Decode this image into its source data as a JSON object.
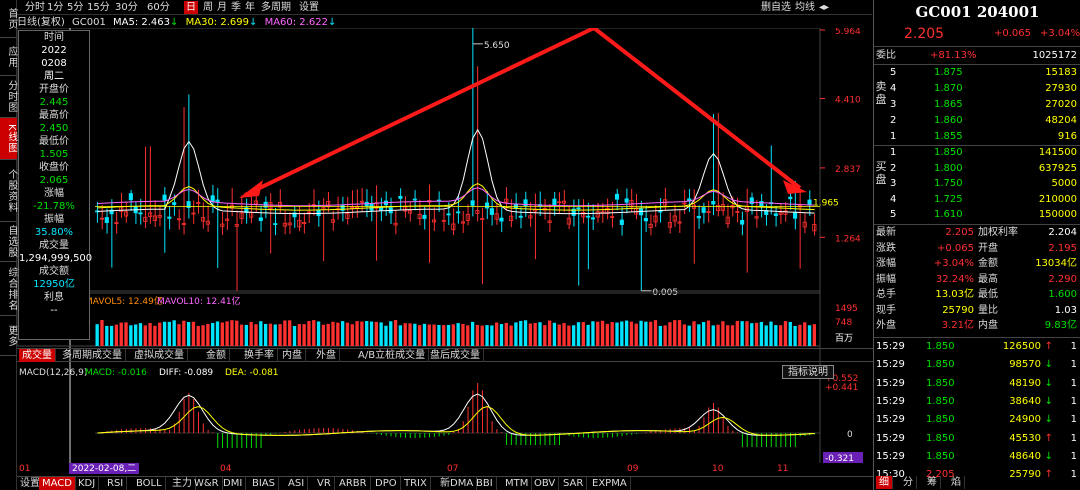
{
  "left_tabs": [
    "首页",
    "应用",
    "分时图",
    "K线图",
    "个股资料",
    "自选股",
    "综合排名",
    "更多"
  ],
  "toolbar": {
    "items": [
      "分时",
      "1分",
      "5分",
      "15分",
      "30分",
      "60分",
      "日",
      "周",
      "月",
      "季",
      "年",
      "多周期",
      "设置"
    ],
    "active_index": 6,
    "right_items": [
      "删自选",
      "均线"
    ]
  },
  "infoline": {
    "title": "日线(复权)",
    "code": "GC001",
    "ma5": "MA5: 2.463",
    "ma30": "MA30: 2.699",
    "ma60": "MA60: 2.622"
  },
  "infobox": {
    "rows": [
      {
        "label": "时间",
        "value": "2022"
      },
      {
        "label": "",
        "value": "0208"
      },
      {
        "label": "",
        "value": "周二"
      },
      {
        "label": "开盘价",
        "value": "2.445"
      },
      {
        "label": "最高价",
        "value": "2.450"
      },
      {
        "label": "最低价",
        "value": "1.505"
      },
      {
        "label": "收盘价",
        "value": "2.065"
      },
      {
        "label": "涨幅",
        "value": "-21.78%"
      },
      {
        "label": "振幅",
        "value": "35.80%"
      },
      {
        "label": "成交量",
        "value": "1,294,999,500"
      },
      {
        "label": "成交额",
        "value": "12950亿"
      },
      {
        "label": "利息",
        "value": "--"
      }
    ]
  },
  "price_axis": [
    "5.964",
    "4.410",
    "2.837",
    "1.264"
  ],
  "annotations": {
    "high": "5.650",
    "low": "0.005",
    "last": "1.965"
  },
  "volume": {
    "mavol5": "MAVOL5: 12.49亿",
    "mavol10": "MAVOL10: 12.41亿",
    "axis": [
      "1495",
      "748",
      "百万"
    ]
  },
  "vol_tabs": [
    "成交量",
    "多周期成交量",
    "虚拟成交量",
    "金额",
    "换手率",
    "内盘",
    "外盘",
    "A/B立桩成交量",
    "盘后成交量"
  ],
  "macd": {
    "title": "MACD(12,26,9)",
    "macd": "MACD: -0.016",
    "diff": "DIFF: -0.089",
    "dea": "DEA: -0.081",
    "button": "指标说明",
    "axis": [
      "+0.552",
      "+0.441",
      "0",
      "-0.321"
    ]
  },
  "x_labels": [
    "01",
    "04",
    "07",
    "09",
    "10",
    "11"
  ],
  "cursor_date": "2022-02-08,二",
  "bottom_tabs": [
    "设置",
    "MACD",
    "KDJ",
    "RSI",
    "BOLL",
    "主力",
    "W&R",
    "DMI",
    "BIAS",
    "ASI",
    "VR",
    "ARBR",
    "DPO",
    "TRIX",
    "新DMA",
    "BBI",
    "MTM",
    "OBV",
    "SAR",
    "EXPMA"
  ],
  "quote": {
    "title": "GC001 204001",
    "price": "2.205",
    "change": "+0.065",
    "change_pct": "+3.04%",
    "webi_label": "委比",
    "webi": "+81.13%",
    "webi_diff": "1025172",
    "sell_label": "卖盘",
    "sell": [
      {
        "n": "5",
        "p": "1.875",
        "v": "15183"
      },
      {
        "n": "4",
        "p": "1.870",
        "v": "27930"
      },
      {
        "n": "3",
        "p": "1.865",
        "v": "27020"
      },
      {
        "n": "2",
        "p": "1.860",
        "v": "48204"
      },
      {
        "n": "1",
        "p": "1.855",
        "v": "916"
      }
    ],
    "buy_label": "买盘",
    "buy": [
      {
        "n": "1",
        "p": "1.850",
        "v": "141500"
      },
      {
        "n": "2",
        "p": "1.800",
        "v": "637925"
      },
      {
        "n": "3",
        "p": "1.750",
        "v": "5000"
      },
      {
        "n": "4",
        "p": "1.725",
        "v": "210000"
      },
      {
        "n": "5",
        "p": "1.610",
        "v": "150000"
      }
    ],
    "stats": [
      {
        "l1": "最新",
        "v1": "2.205",
        "l2": "加权利率",
        "v2": "2.204"
      },
      {
        "l1": "涨跌",
        "v1": "+0.065",
        "l2": "开盘",
        "v2": "2.195"
      },
      {
        "l1": "涨幅",
        "v1": "+3.04%",
        "l2": "金额",
        "v2": "13034亿"
      },
      {
        "l1": "振幅",
        "v1": "32.24%",
        "l2": "最高",
        "v2": "2.290"
      },
      {
        "l1": "总手",
        "v1": "13.03亿",
        "l2": "最低",
        "v2": "1.600"
      },
      {
        "l1": "现手",
        "v1": "25790",
        "l2": "量比",
        "v2": "1.03"
      },
      {
        "l1": "外盘",
        "v1": "3.21亿",
        "l2": "内盘",
        "v2": "9.83亿"
      }
    ],
    "ticks": [
      {
        "t": "15:29",
        "p": "1.850",
        "v": "126500",
        "d": "up",
        "n": "1"
      },
      {
        "t": "15:29",
        "p": "1.850",
        "v": "98570",
        "d": "down",
        "n": "1"
      },
      {
        "t": "15:29",
        "p": "1.850",
        "v": "48190",
        "d": "down",
        "n": "1"
      },
      {
        "t": "15:29",
        "p": "1.850",
        "v": "38640",
        "d": "down",
        "n": "1"
      },
      {
        "t": "15:29",
        "p": "1.850",
        "v": "24900",
        "d": "down",
        "n": "1"
      },
      {
        "t": "15:29",
        "p": "1.850",
        "v": "45530",
        "d": "up",
        "n": "1"
      },
      {
        "t": "15:29",
        "p": "1.850",
        "v": "48640",
        "d": "down",
        "n": "1"
      },
      {
        "t": "15:30",
        "p": "2.205",
        "v": "25790",
        "d": "up",
        "n": "1"
      }
    ],
    "bottom_tabs": [
      "细",
      "分",
      "筹",
      "焰"
    ]
  }
}
